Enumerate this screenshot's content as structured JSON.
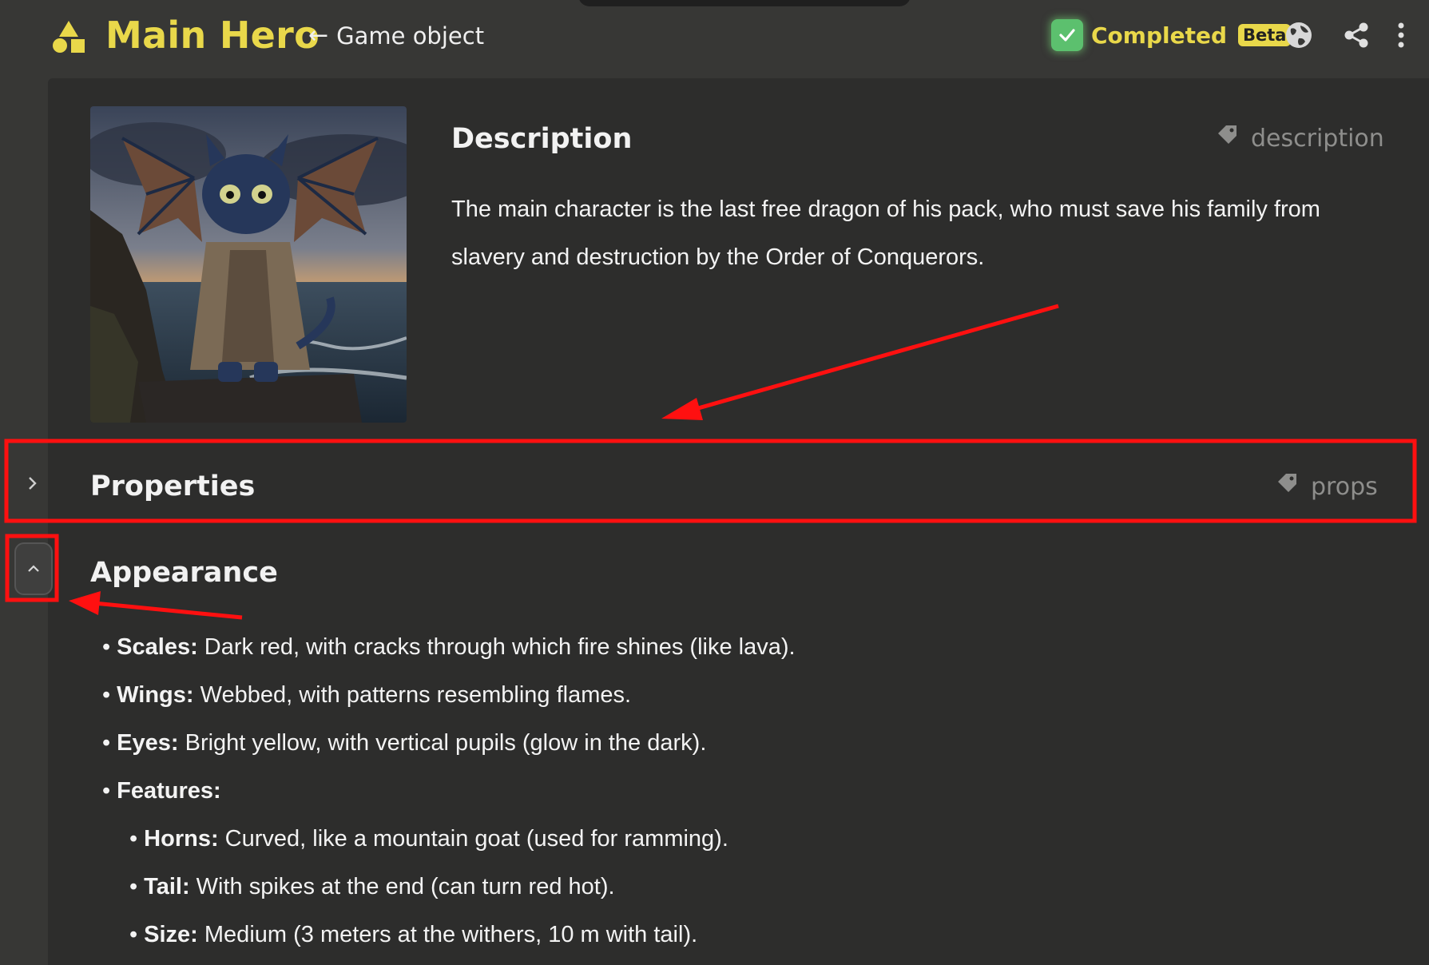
{
  "header": {
    "title": "Main Hero",
    "back_link": "Game object",
    "status_label": "Completed",
    "beta_badge": "Beta",
    "accent_color": "#e9d84a",
    "icons": [
      "shapes-icon",
      "check-icon",
      "globe-icon",
      "share-icon",
      "more-vert-icon"
    ]
  },
  "description": {
    "title": "Description",
    "tag": "description",
    "text": "The main character is the last free dragon of his pack, who must save his family from slavery and destruction by the Order of Conquerors."
  },
  "properties": {
    "title": "Properties",
    "tag": "props"
  },
  "appearance": {
    "title": "Appearance",
    "items": [
      {
        "label": "Scales:",
        "text": " Dark red, with cracks through which fire shines (like lava).",
        "level": 0
      },
      {
        "label": "Wings:",
        "text": " Webbed, with patterns resembling flames.",
        "level": 0
      },
      {
        "label": "Eyes:",
        "text": " Bright yellow, with vertical pupils (glow in the dark).",
        "level": 0
      },
      {
        "label": "Features:",
        "text": "",
        "level": 0
      },
      {
        "label": "Horns:",
        "text": " Curved, like a mountain goat (used for ramming).",
        "level": 1
      },
      {
        "label": "Tail:",
        "text": " With spikes at the end (can turn red hot).",
        "level": 1
      },
      {
        "label": "Size:",
        "text": " Medium (3 meters at the withers, 10 m with tail).",
        "level": 1
      }
    ]
  },
  "annotation_color": "#ff1010"
}
